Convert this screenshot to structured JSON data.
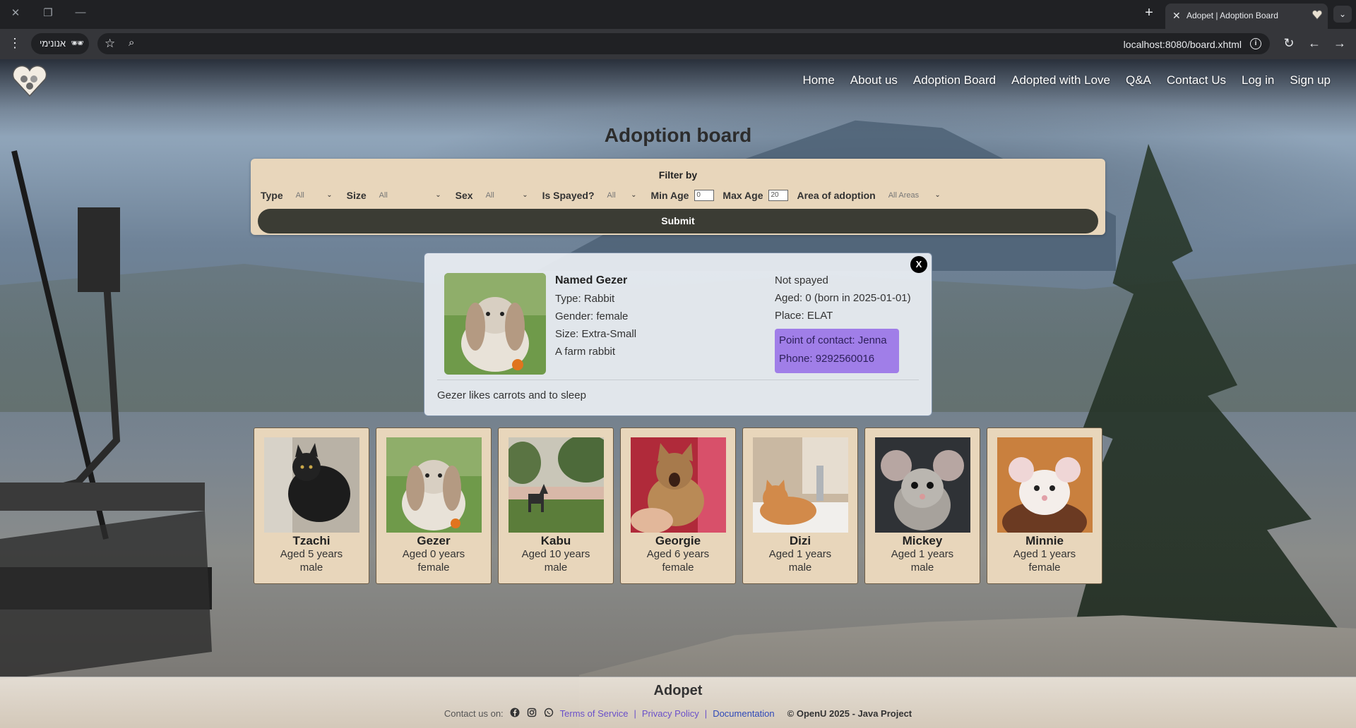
{
  "browser": {
    "tab_title": "Adopet | Adoption Board",
    "incognito_label": "אנונימי",
    "url": "localhost:8080/board.xhtml"
  },
  "nav": {
    "items": [
      "Home",
      "About us",
      "Adoption Board",
      "Adopted with Love",
      "Q&A",
      "Contact Us",
      "Log in",
      "Sign up"
    ]
  },
  "page_title": "Adoption board",
  "filter": {
    "title": "Filter by",
    "type_label": "Type",
    "type_value": "All",
    "size_label": "Size",
    "size_value": "All",
    "sex_label": "Sex",
    "sex_value": "All",
    "spayed_label": "Is Spayed?",
    "spayed_value": "All",
    "min_age_label": "Min Age",
    "min_age_value": "0",
    "max_age_label": "Max Age",
    "max_age_value": "20",
    "area_label": "Area of adoption",
    "area_value": "All Areas",
    "submit_label": "Submit"
  },
  "detail": {
    "name": "Named Gezer",
    "type": "Type: Rabbit",
    "gender": "Gender: female",
    "size": "Size: Extra-Small",
    "breed": "A farm rabbit",
    "spayed": "Not spayed",
    "aged": "Aged: 0 (born in 2025-01-01)",
    "place": "Place: ELAT",
    "contact": "Point of contact: Jenna",
    "phone": "Phone: 9292560016",
    "description": "Gezer likes carrots and to sleep",
    "close_label": "X"
  },
  "pets": [
    {
      "name": "Tzachi",
      "age": "Aged 5 years",
      "sex": "male",
      "photo": "black-cat"
    },
    {
      "name": "Gezer",
      "age": "Aged 0 years",
      "sex": "female",
      "photo": "rabbit"
    },
    {
      "name": "Kabu",
      "age": "Aged 10 years",
      "sex": "male",
      "photo": "dog-lake"
    },
    {
      "name": "Georgie",
      "age": "Aged 6 years",
      "sex": "female",
      "photo": "tabby-cat"
    },
    {
      "name": "Dizi",
      "age": "Aged 1 years",
      "sex": "male",
      "photo": "ginger-cat"
    },
    {
      "name": "Mickey",
      "age": "Aged 1 years",
      "sex": "male",
      "photo": "grey-mouse"
    },
    {
      "name": "Minnie",
      "age": "Aged 1 years",
      "sex": "female",
      "photo": "white-mouse"
    }
  ],
  "footer": {
    "title": "Adopet",
    "contact_label": "Contact us on:",
    "terms": "Terms of Service",
    "privacy": "Privacy Policy",
    "docs": "Documentation",
    "separator": "|",
    "copyright": "© OpenU 2025 - Java Project"
  }
}
